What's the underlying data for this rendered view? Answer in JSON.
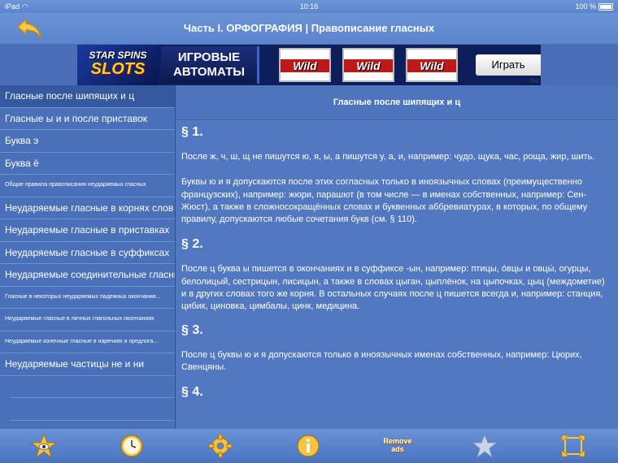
{
  "status": {
    "device": "iPad",
    "time": "10:16",
    "battery": "100 %"
  },
  "nav": {
    "title": "Часть I. ОРФОГРАФИЯ  |  Правописание гласных"
  },
  "ad": {
    "logo_line1": "STAR SPINS",
    "logo_line2": "SLOTS",
    "headline": "ИГРОВЫЕ АВТОМАТЫ",
    "reel_text": "Wild",
    "cta": "Играть",
    "badge": "iAd"
  },
  "sidebar": {
    "items": [
      {
        "label": "Гласные после шипящих и ц"
      },
      {
        "label": "Гласные ы и и после приставок"
      },
      {
        "label": "Буква э"
      },
      {
        "label": "Буква ё"
      },
      {
        "label": "Общие правила правописания неударяемых гласных"
      },
      {
        "label": "Неударяемые гласные в корнях слов"
      },
      {
        "label": "Неударяемые гласные в приставках"
      },
      {
        "label": "Неударяемые гласные в суффиксах"
      },
      {
        "label": "Неударяемые соединительные гласные"
      },
      {
        "label": "Гласные в некоторых неударяемых падежных окончания..."
      },
      {
        "label": "Неударяемые гласные в личных глагольных окончаниях"
      },
      {
        "label": "Неударяемые конечные гласные в наречиях и предлога..."
      },
      {
        "label": "Неударяемые частицы не и ни"
      }
    ]
  },
  "content": {
    "header": "Гласные после шипящих и ц",
    "sections": [
      {
        "title": "§ 1.",
        "p1": "После ж, ч, ш, щ не пишутся ю, я, ы, а пишутся у, а, и, например: чудо, щука, час, роща, жир, шить.",
        "p2": "Буквы ю и я допускаются после этих согласных только в иноязычных словах (преимущественно французских), например: жюри, парашют (в том числе — в именах собственных, например: Сен-Жюст), а также в сложносокращённых словах и буквенных аббревиатурах, в которых, по общему правилу, допускаются любые сочетания букв (см. § 110)."
      },
      {
        "title": "§ 2.",
        "p1": "После ц буква ы пишется в окончаниях и в суффиксе -ын, например: птицы, о́вцы и овцы́, огурцы, белолицый, сестрицын, лисицын, а также в словах цыган, цыплёнок, на цыпочках, цыц (междометие) и в других словах того же корня. В остальных случаях после ц пишется всегда и, например: станция, цибик, циновка, цимбалы, цинк, медицина."
      },
      {
        "title": "§ 3.",
        "p1": "После ц буквы ю и я допускаются только в иноязычных именах собственных, например: Цюрих, Свенцяны."
      },
      {
        "title": "§ 4."
      }
    ]
  },
  "tabbar": {
    "remove_ads": "Remove ads"
  }
}
